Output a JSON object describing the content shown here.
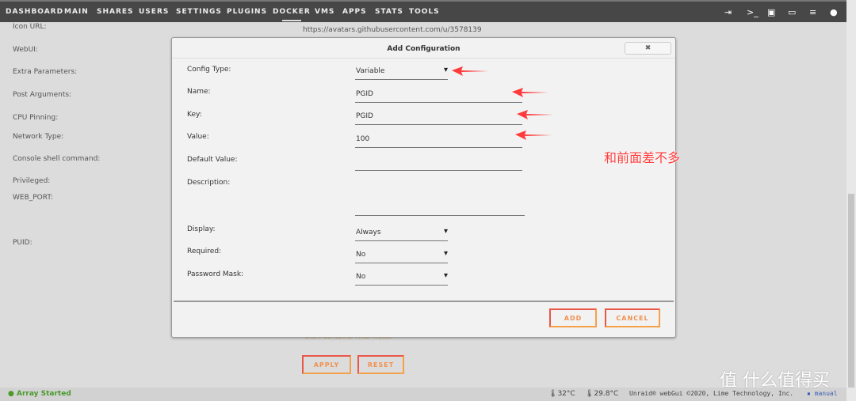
{
  "nav": {
    "items": [
      "DASHBOARD",
      "MAIN",
      "SHARES",
      "USERS",
      "SETTINGS",
      "PLUGINS",
      "DOCKER",
      "VMS",
      "APPS",
      "STATS",
      "TOOLS"
    ],
    "active": "DOCKER",
    "icons": [
      "logout-icon",
      "terminal-icon",
      "feedback-icon",
      "monitor-icon",
      "log-icon",
      "help-icon"
    ]
  },
  "background": {
    "labels": [
      "Icon URL:",
      "WebUI:",
      "Extra Parameters:",
      "Post Arguments:",
      "CPU Pinning:",
      "Network Type:",
      "Console shell command:",
      "Privileged:",
      "WEB_PORT:",
      "PUID:"
    ],
    "icon_url": "https://avatars.githubusercontent.com/u/3578139",
    "start_after_install": "Start Container After Install",
    "apply": "APPLY",
    "reset": "RESET"
  },
  "modal": {
    "title": "Add Configuration",
    "close": "✖",
    "fields": {
      "config_type_label": "Config Type:",
      "config_type": "Variable",
      "name_label": "Name:",
      "name": "PGID",
      "key_label": "Key:",
      "key": "PGID",
      "value_label": "Value:",
      "value": "100",
      "default_label": "Default Value:",
      "default": "",
      "description_label": "Description:",
      "description": "",
      "display_label": "Display:",
      "display": "Always",
      "required_label": "Required:",
      "required": "No",
      "password_label": "Password Mask:",
      "password": "No"
    },
    "add": "ADD",
    "cancel": "CANCEL"
  },
  "annotation": {
    "note": "和前面差不多",
    "arrow_color": "#ff3a3a"
  },
  "status": {
    "array": "Array Started",
    "temp1": "32°C",
    "temp2": "29.8°C",
    "footer": "Unraid® webGui ©2020, Lime Technology, Inc.",
    "manual": "manual"
  },
  "watermark": "值 什么值得买"
}
